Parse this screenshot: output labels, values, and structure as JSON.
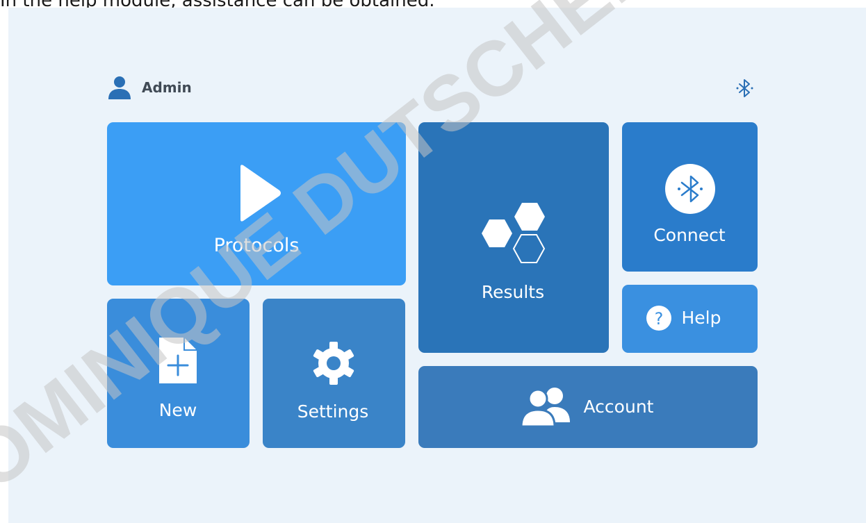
{
  "caption": "In the help module, assistance can be obtained.",
  "header": {
    "user_name": "Admin"
  },
  "tiles": {
    "protocols": "Protocols",
    "new": "New",
    "settings": "Settings",
    "results": "Results",
    "connect": "Connect",
    "help": "Help",
    "account": "Account"
  },
  "watermark": "DOMINIQUE DUTSCHER",
  "icons": {
    "user": "user-icon",
    "bluetooth": "bluetooth-icon",
    "play": "play-icon",
    "new_file": "new-file-icon",
    "gear": "gear-icon",
    "hexagons": "hexagons-icon",
    "help": "question-icon",
    "users": "users-icon"
  },
  "colors": {
    "background": "#ebf3fa",
    "protocols": "#3b9ef5",
    "new": "#3a8ddb",
    "settings": "#3a84c8",
    "results": "#2a74b8",
    "connect": "#2a7ccb",
    "help": "#3a90e0",
    "account": "#3a7bbb",
    "icon_dark": "#2a6fb5"
  }
}
